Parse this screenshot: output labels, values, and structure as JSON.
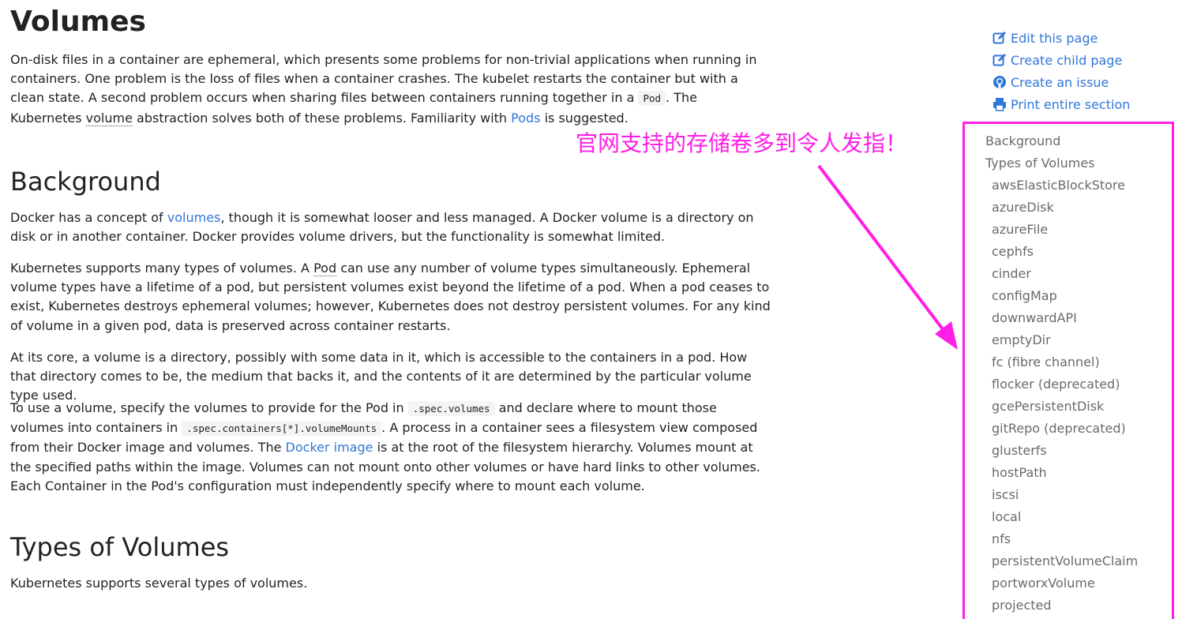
{
  "page": {
    "title": "Volumes",
    "intro": {
      "t1": "On-disk files in a container are ephemeral, which presents some problems for non-trivial applications when running in containers. One problem is the loss of files when a container crashes. The kubelet restarts the container but with a clean state. A second problem occurs when sharing files between containers running together in a ",
      "code1": "Pod",
      "t2": ". The Kubernetes ",
      "gloss1": "volume",
      "t3": " abstraction solves both of these problems. Familiarity with ",
      "link1": "Pods",
      "t4": " is suggested."
    },
    "background": {
      "heading": "Background",
      "p1": {
        "t1": "Docker has a concept of ",
        "link": "volumes",
        "t2": ", though it is somewhat looser and less managed. A Docker volume is a directory on disk or in another container. Docker provides volume drivers, but the functionality is somewhat limited."
      },
      "p2": {
        "t1": "Kubernetes supports many types of volumes. A ",
        "gloss": "Pod",
        "t2": " can use any number of volume types simultaneously. Ephemeral volume types have a lifetime of a pod, but persistent volumes exist beyond the lifetime of a pod. When a pod ceases to exist, Kubernetes destroys ephemeral volumes; however, Kubernetes does not destroy persistent volumes. For any kind of volume in a given pod, data is preserved across container restarts."
      },
      "p3": "At its core, a volume is a directory, possibly with some data in it, which is accessible to the containers in a pod. How that directory comes to be, the medium that backs it, and the contents of it are determined by the particular volume type used.",
      "p4": {
        "t1": "To use a volume, specify the volumes to provide for the Pod in ",
        "code1": ".spec.volumes",
        "t2": " and declare where to mount those volumes into containers in ",
        "code2": ".spec.containers[*].volumeMounts",
        "t3": ". A process in a container sees a filesystem view composed from their Docker image and volumes. The ",
        "link": "Docker image",
        "t4": " is at the root of the filesystem hierarchy. Volumes mount at the specified paths within the image. Volumes can not mount onto other volumes or have hard links to other volumes. Each Container in the Pod's configuration must independently specify where to mount each volume."
      }
    },
    "types": {
      "heading": "Types of Volumes",
      "p1": "Kubernetes supports several types of volumes."
    }
  },
  "actions": [
    {
      "label": "Edit this page",
      "icon": "edit-icon"
    },
    {
      "label": "Create child page",
      "icon": "edit-icon"
    },
    {
      "label": "Create an issue",
      "icon": "github-icon"
    },
    {
      "label": "Print entire section",
      "icon": "print-icon"
    }
  ],
  "toc": {
    "top": [
      "Background",
      "Types of Volumes"
    ],
    "sub": [
      "awsElasticBlockStore",
      "azureDisk",
      "azureFile",
      "cephfs",
      "cinder",
      "configMap",
      "downwardAPI",
      "emptyDir",
      "fc (fibre channel)",
      "flocker (deprecated)",
      "gcePersistentDisk",
      "gitRepo (deprecated)",
      "glusterfs",
      "hostPath",
      "iscsi",
      "local",
      "nfs",
      "persistentVolumeClaim",
      "portworxVolume",
      "projected"
    ]
  },
  "annotation": "官网支持的存储卷多到令人发指！",
  "colors": {
    "link": "#3176d9",
    "annotation": "#ff1ee6",
    "toc_text": "#6a6a6a"
  }
}
